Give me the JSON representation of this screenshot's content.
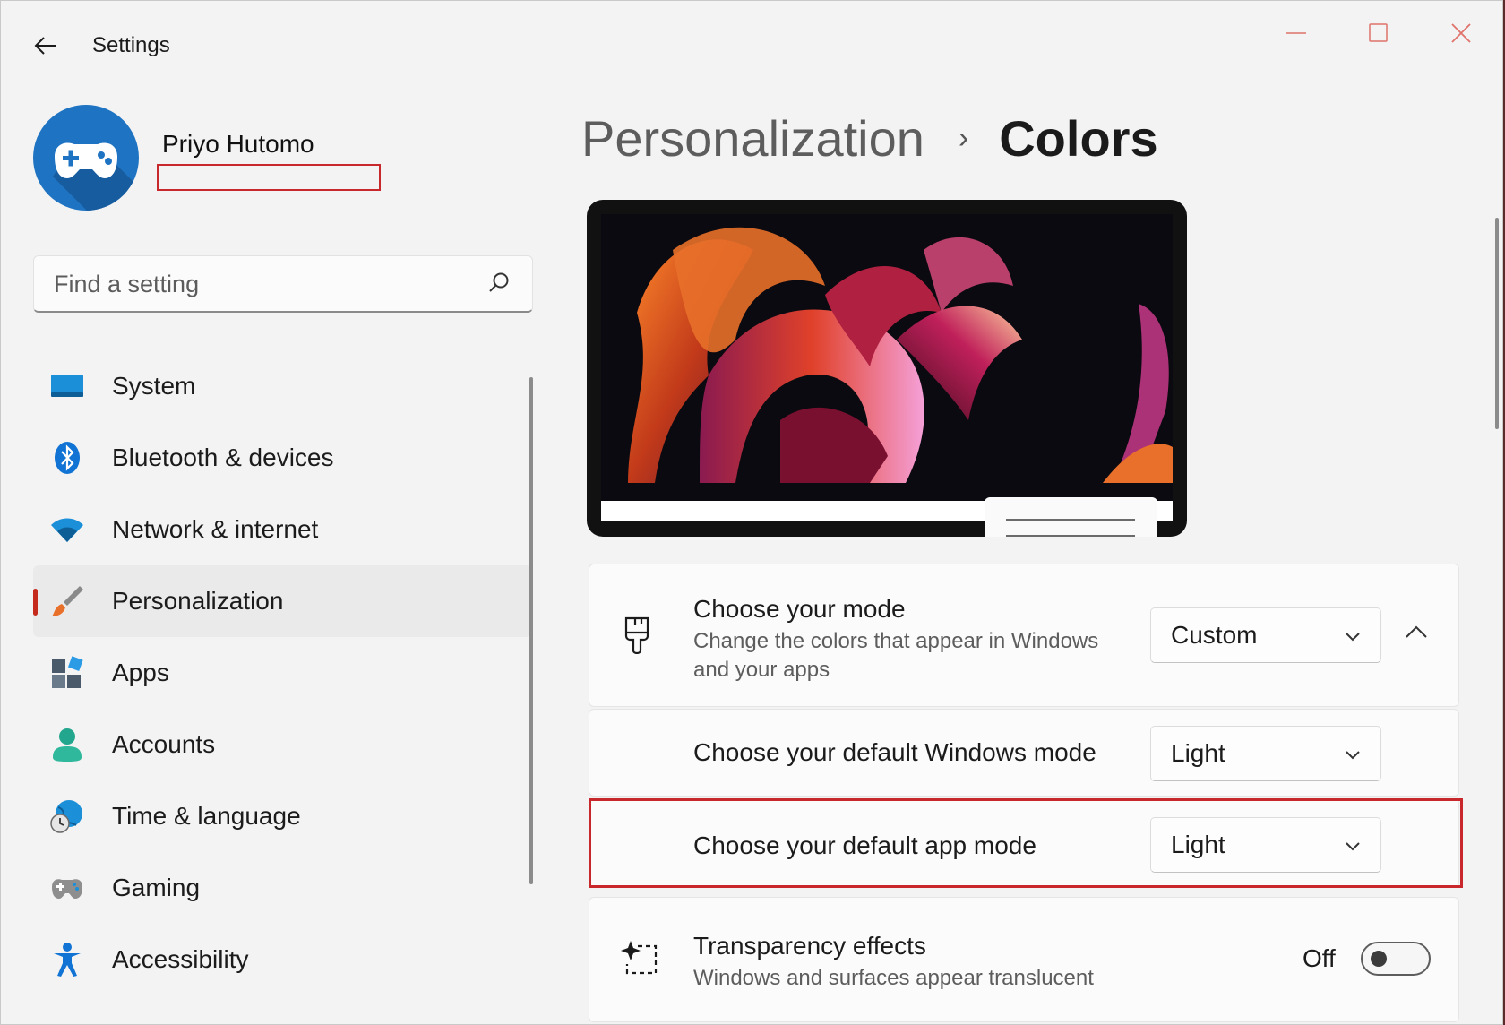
{
  "window": {
    "title": "Settings",
    "controls": [
      "minimize",
      "maximize",
      "close"
    ]
  },
  "user": {
    "name": "Priyo Hutomo"
  },
  "search": {
    "placeholder": "Find a setting"
  },
  "nav": {
    "items": [
      {
        "label": "System",
        "icon": "system-icon"
      },
      {
        "label": "Bluetooth & devices",
        "icon": "bluetooth-icon"
      },
      {
        "label": "Network & internet",
        "icon": "wifi-icon"
      },
      {
        "label": "Personalization",
        "icon": "paintbrush-icon",
        "selected": true
      },
      {
        "label": "Apps",
        "icon": "apps-icon"
      },
      {
        "label": "Accounts",
        "icon": "accounts-icon"
      },
      {
        "label": "Time & language",
        "icon": "globe-clock-icon"
      },
      {
        "label": "Gaming",
        "icon": "gamepad-icon"
      },
      {
        "label": "Accessibility",
        "icon": "accessibility-icon"
      }
    ]
  },
  "breadcrumb": {
    "parent": "Personalization",
    "separator": "›",
    "current": "Colors"
  },
  "settings": {
    "mode": {
      "title": "Choose your mode",
      "description": "Change the colors that appear in Windows and your apps",
      "value": "Custom"
    },
    "windows_mode": {
      "title": "Choose your default Windows mode",
      "value": "Light"
    },
    "app_mode": {
      "title": "Choose your default app mode",
      "value": "Light"
    },
    "transparency": {
      "title": "Transparency effects",
      "description": "Windows and surfaces appear translucent",
      "state_label": "Off",
      "on": false
    }
  },
  "colors": {
    "accent": "#c42b1c",
    "highlight": "#c8282c",
    "window_bg": "#f3f3f3"
  }
}
